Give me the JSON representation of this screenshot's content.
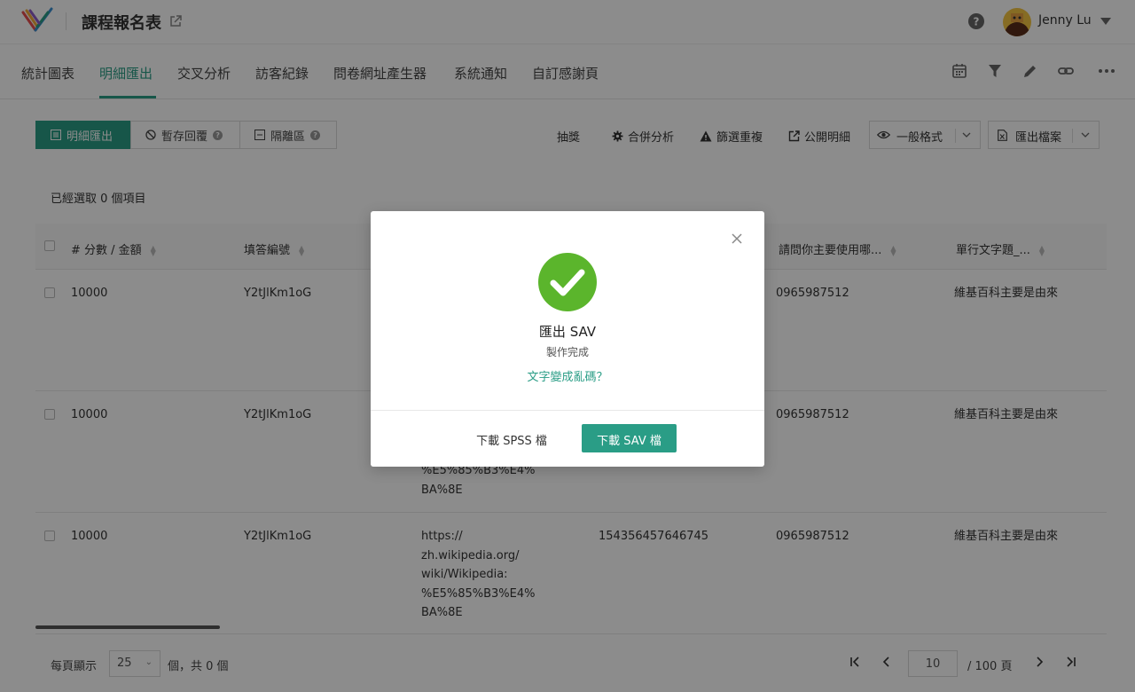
{
  "header": {
    "form_title": "課程報名表",
    "user_name": "Jenny Lu"
  },
  "nav": {
    "tabs": [
      {
        "label": "統計圖表",
        "active": false
      },
      {
        "label": "明細匯出",
        "active": true
      },
      {
        "label": "交叉分析",
        "active": false
      },
      {
        "label": "訪客紀錄",
        "active": false
      },
      {
        "label": "問卷網址產生器",
        "active": false
      },
      {
        "label": "系統通知",
        "active": false
      },
      {
        "label": "自訂感謝頁",
        "active": false
      }
    ],
    "icons": [
      "calendar-icon",
      "filter-icon",
      "pencil-icon",
      "link-icon",
      "more-icon"
    ]
  },
  "toolbar": {
    "segments": [
      {
        "label": "明細匯出",
        "icon": "list-icon",
        "active": true
      },
      {
        "label": "暫存回覆",
        "icon": "ban-icon",
        "help": true
      },
      {
        "label": "隔離區",
        "icon": "minus-box-icon",
        "help": true
      }
    ],
    "lottery": "抽獎",
    "merge": "合併分析",
    "dedupe": "篩選重複",
    "public": "公開明細",
    "format": "一般格式",
    "export": "匯出檔案"
  },
  "selection": {
    "text": "已經選取 0 個項目"
  },
  "table": {
    "columns": [
      "# 分數 / 金額",
      "填答編號",
      "請問你主要使用哪...",
      "單行文字題_..."
    ],
    "rows": [
      {
        "score": "10000",
        "id": "Y2tJlKm1oG",
        "url_lines": [],
        "number": "",
        "phone": "0965987512",
        "text": "維基百科主要是由來"
      },
      {
        "score": "10000",
        "id": "Y2tJlKm1oG",
        "url_lines": [
          "%E5%85%B3%E4%",
          "BA%8E"
        ],
        "number": "",
        "phone": "0965987512",
        "text": "維基百科主要是由來"
      },
      {
        "score": "10000",
        "id": "Y2tJlKm1oG",
        "url_lines": [
          "https://",
          "zh.wikipedia.org/",
          "wiki/Wikipedia:",
          "%E5%85%B3%E4%",
          "BA%8E"
        ],
        "number": "154356457646745",
        "phone": "0965987512",
        "text": "維基百科主要是由來"
      }
    ]
  },
  "pagination": {
    "per_page_label": "每頁顯示",
    "per_page": "25",
    "total": "個，共 0 個",
    "page": "10",
    "of_pages": "/  100 頁"
  },
  "modal": {
    "title": "匯出 SAV",
    "subtitle": "製作完成",
    "link": "文字變成亂碼？",
    "btn_spss": "下載 SPSS 檔",
    "btn_sav": "下載 SAV 檔",
    "accent": "#2a9d86",
    "success_color": "#5bb52c"
  }
}
